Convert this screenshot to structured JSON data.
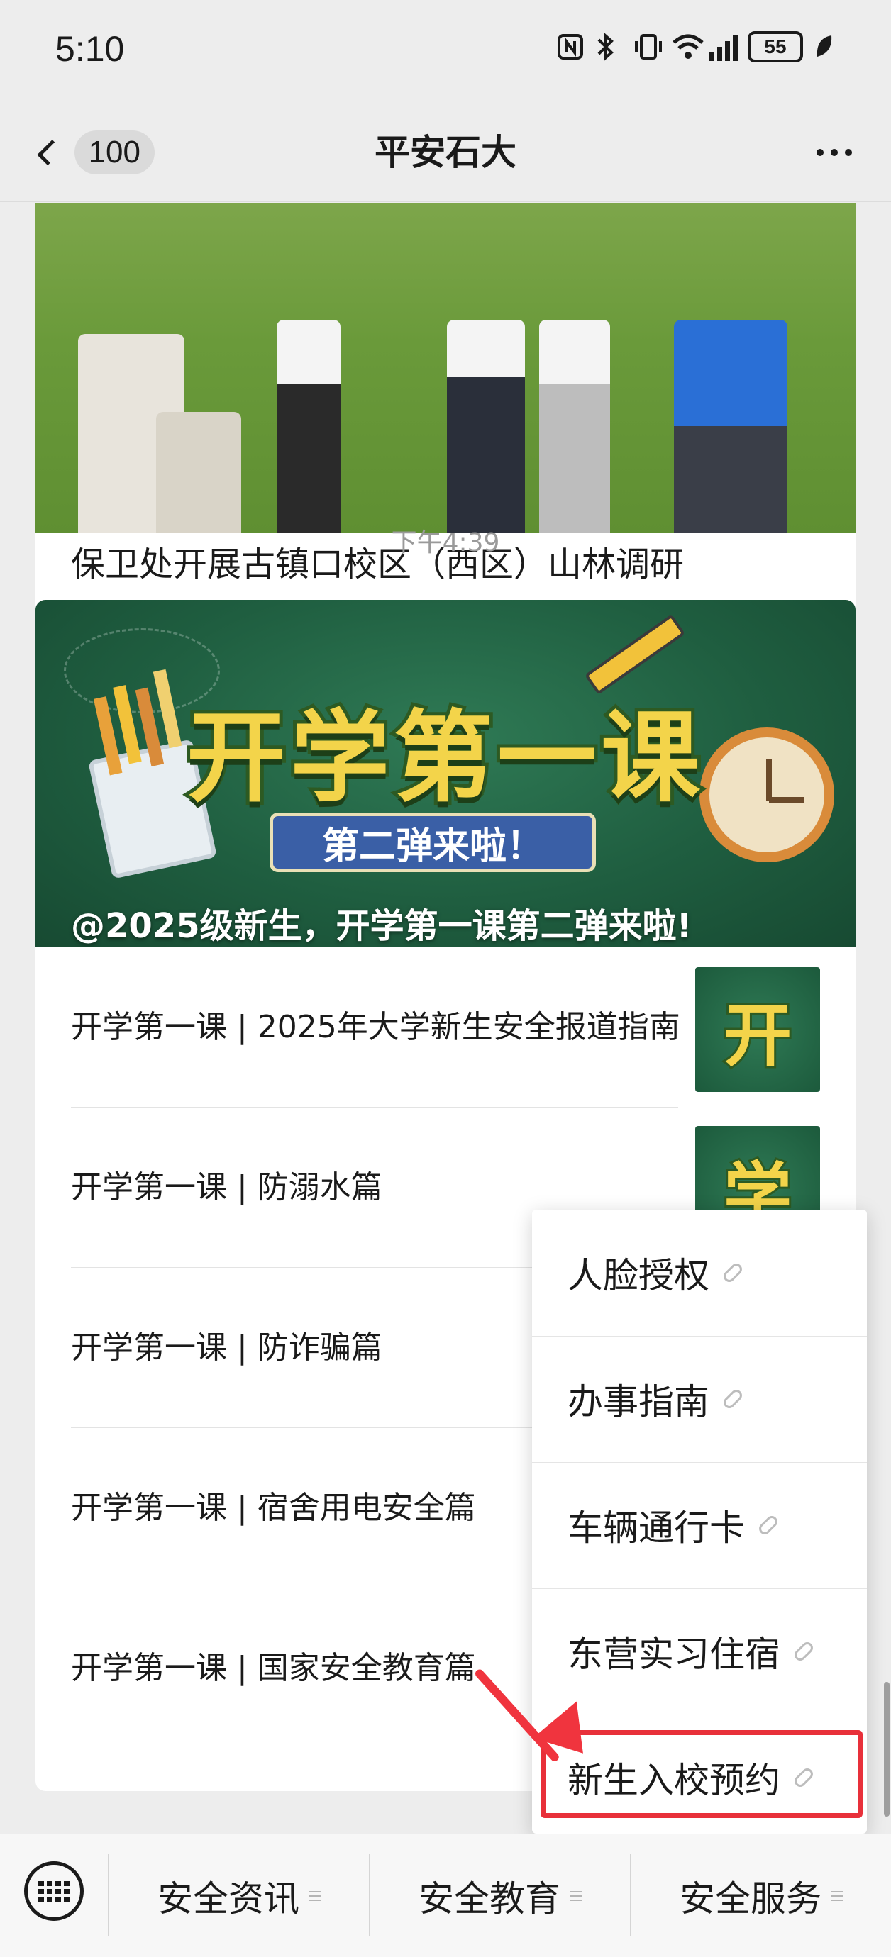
{
  "status_bar": {
    "time": "5:10",
    "battery": "55",
    "icons": [
      "nfc-icon",
      "bluetooth-icon",
      "vibrate-icon",
      "wifi-icon",
      "signal-icon",
      "battery-icon",
      "leaf-icon"
    ]
  },
  "nav": {
    "unread_count": "100",
    "title": "平安石大"
  },
  "messages": {
    "top_card_title": "保卫处开展古镇口校区（西区）山林调研",
    "timestamp": "下午4:39",
    "cover": {
      "big_text": "开学第一课",
      "ribbon_text": "第二弹来啦！",
      "caption": "@2025级新生，开学第一课第二弹来啦!"
    },
    "items": [
      {
        "title": "开学第一课 | 2025年大学新生安全报道指南",
        "thumb_char": "开"
      },
      {
        "title": "开学第一课 | 防溺水篇",
        "thumb_char": "学"
      },
      {
        "title": "开学第一课 | 防诈骗篇"
      },
      {
        "title": "开学第一课 | 宿舍用电安全篇"
      },
      {
        "title": "开学第一课 | 国家安全教育篇"
      }
    ]
  },
  "popup_menu": {
    "items": [
      "人脸授权",
      "办事指南",
      "车辆通行卡",
      "东营实习住宿",
      "新生入校预约"
    ],
    "highlighted": "新生入校预约"
  },
  "bottom_menu": {
    "tabs": [
      "安全资讯",
      "安全教育",
      "安全服务"
    ]
  },
  "colors": {
    "background": "#ededed",
    "highlight": "#e8303a",
    "cover_green": "#1f5e40"
  }
}
